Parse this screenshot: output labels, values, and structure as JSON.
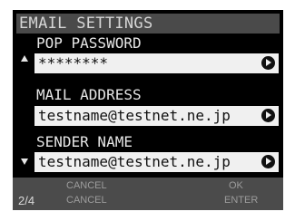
{
  "header": {
    "title": "EMAIL SETTINGS"
  },
  "fields": [
    {
      "label": "POP PASSWORD",
      "value": "********"
    },
    {
      "label": "MAIL ADDRESS",
      "value": "testname@testnet.ne.jp"
    },
    {
      "label": "SENDER NAME",
      "value": "testname@testnet.ne.jp"
    }
  ],
  "footer": {
    "page": "2/4",
    "cancel_top": "CANCEL",
    "cancel_bottom": "CANCEL",
    "ok": "OK",
    "enter": "ENTER"
  },
  "icons": {
    "field_action": "circle-arrow-right-icon",
    "scroll_up": "triangle-up-icon",
    "scroll_down": "triangle-down-icon"
  },
  "colors": {
    "background": "#000000",
    "title_bar": "#4a4a4a",
    "field_bg": "#f0f0f0",
    "footer_bg": "#4b4b4b",
    "text_light": "#e6e6e6",
    "text_dim": "#9c9c9c"
  }
}
